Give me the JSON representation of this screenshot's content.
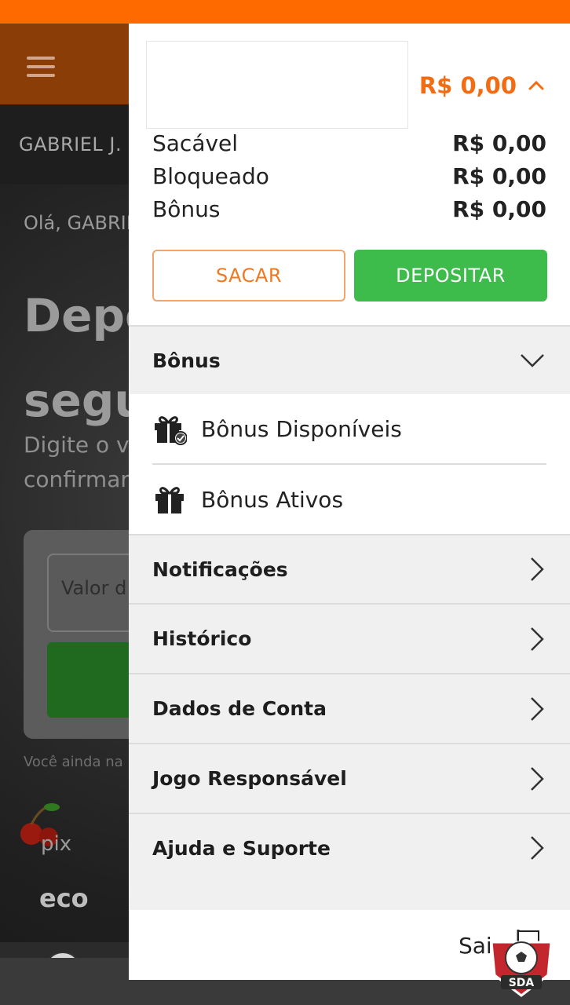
{
  "background": {
    "user_name": "GABRIEL J.",
    "hello": "Olá, GABRIE",
    "title_line1": "Depo",
    "title_line2": "segu",
    "subtitle_line1": "Digite o va",
    "subtitle_line2": "confirmar",
    "input_placeholder": "Valor d",
    "note": "Você ainda na",
    "pix_label": "pix",
    "eco_label": "eco"
  },
  "drawer": {
    "balance": "R$ 0,00",
    "rows": [
      {
        "label": "Sacável",
        "value": "R$ 0,00"
      },
      {
        "label": "Bloqueado",
        "value": "R$ 0,00"
      },
      {
        "label": "Bônus",
        "value": "R$ 0,00"
      }
    ],
    "btn_sacar": "SACAR",
    "btn_depositar": "DEPOSITAR",
    "bonus_section": "Bônus",
    "bonus_items": [
      {
        "label": "Bônus Disponíveis",
        "icon": "gift-check-icon"
      },
      {
        "label": "Bônus Ativos",
        "icon": "gift-icon"
      }
    ],
    "menu": [
      {
        "label": "Notificações"
      },
      {
        "label": "Histórico"
      },
      {
        "label": "Dados de Conta"
      },
      {
        "label": "Jogo Responsável"
      },
      {
        "label": "Ajuda e Suporte"
      }
    ],
    "logout": "Sair"
  },
  "watermark": "SDA",
  "colors": {
    "accent_orange": "#f36c12",
    "green": "#3dbb4b",
    "topbar": "#ff6a00"
  }
}
